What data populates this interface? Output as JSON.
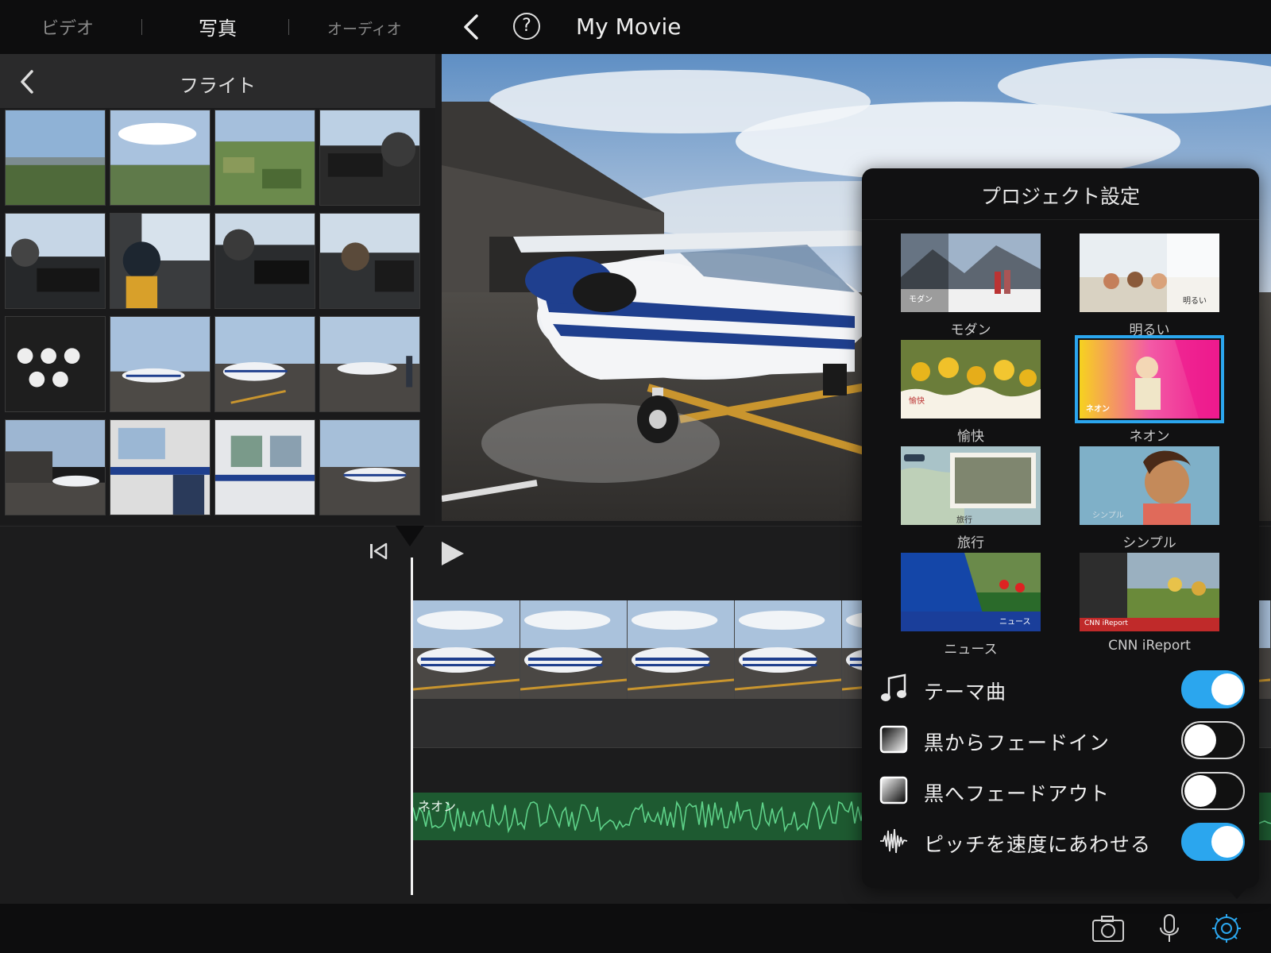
{
  "top_bar": {
    "tabs": [
      {
        "label": "ビデオ",
        "active": false
      },
      {
        "label": "写真",
        "active": true
      },
      {
        "label": "オーディオ",
        "active": false
      }
    ],
    "back_icon": "chevron-left-icon",
    "help_label": "?",
    "project_title": "My Movie"
  },
  "browser": {
    "back_icon": "chevron-left-icon",
    "album_title": "フライト",
    "thumbnail_count": 16
  },
  "timeline": {
    "skip_icon": "skip-to-start-icon",
    "play_icon": "play-icon",
    "audio_clip_label": "ネオン"
  },
  "project_settings": {
    "title": "プロジェクト設定",
    "themes": [
      {
        "name": "モダン",
        "badge": "モダン",
        "selected": false
      },
      {
        "name": "明るい",
        "badge": "明るい",
        "selected": false
      },
      {
        "name": "愉快",
        "badge": "愉快",
        "selected": false
      },
      {
        "name": "ネオン",
        "badge": "ネオン",
        "selected": true
      },
      {
        "name": "旅行",
        "badge": "旅行",
        "selected": false
      },
      {
        "name": "シンプル",
        "badge": "シンプル",
        "selected": false
      },
      {
        "name": "ニュース",
        "badge": "ニュース",
        "selected": false
      },
      {
        "name": "CNN iReport",
        "badge": "CNN iReport",
        "selected": false
      }
    ],
    "settings": [
      {
        "label": "テーマ曲",
        "icon": "music-note-icon",
        "on": true
      },
      {
        "label": "黒からフェードイン",
        "icon": "fade-in-icon",
        "on": false
      },
      {
        "label": "黒へフェードアウト",
        "icon": "fade-out-icon",
        "on": false
      },
      {
        "label": "ピッチを速度にあわせる",
        "icon": "waveform-icon",
        "on": true
      }
    ]
  },
  "bottom_bar": {
    "icons": [
      "camera-icon",
      "microphone-icon",
      "settings-gear-icon"
    ]
  },
  "colors": {
    "accent": "#2ba6ee",
    "audio_track": "#1e5a31",
    "background": "#1b1b1c"
  }
}
